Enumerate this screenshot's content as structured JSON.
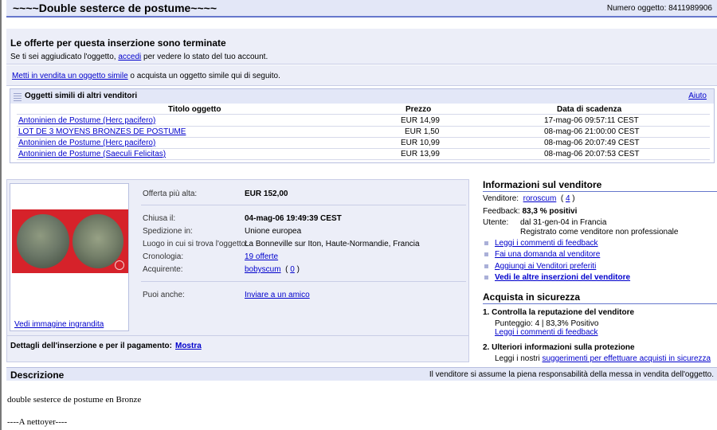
{
  "header": {
    "title": "~~~~Double sesterce de postume~~~~",
    "item_number": "Numero oggetto: 8411989906"
  },
  "ended": {
    "heading": "Le offerte per questa inserzione sono terminate",
    "text_pre": "Se ti sei aggiudicato l'oggetto, ",
    "link": "accedi",
    "text_post": " per vedere lo stato del tuo account."
  },
  "sell_similar": {
    "link": "Metti in vendita un oggetto simile",
    "text": " o acquista un oggetto simile qui di seguito."
  },
  "similar": {
    "title": "Oggetti simili di altri venditori",
    "help": "Aiuto",
    "columns": [
      "Titolo oggetto",
      "Prezzo",
      "Data di scadenza"
    ],
    "rows": [
      {
        "title": "Antoninien de Postume (Herc pacifero)",
        "price": "EUR 14,99",
        "end": "17-mag-06 09:57:11 CEST"
      },
      {
        "title": "LOT DE 3 MOYENS BRONZES DE POSTUME",
        "price": "EUR 1,50",
        "end": "08-mag-06 21:00:00 CEST"
      },
      {
        "title": "Antoninien de Postume (Herc pacifero)",
        "price": "EUR 10,99",
        "end": "08-mag-06 20:07:49 CEST"
      },
      {
        "title": "Antoninien de Postume (Saeculi Felicitas)",
        "price": "EUR 13,99",
        "end": "08-mag-06 20:07:53 CEST"
      }
    ]
  },
  "item": {
    "photo_link": "Vedi immagine ingrandita",
    "top_bid_label": "Offerta più alta:",
    "top_bid_value": "EUR 152,00",
    "closed_label": "Chiusa il:",
    "closed_value": "04-mag-06 19:49:39 CEST",
    "shipping_label": "Spedizione in:",
    "shipping_value": "Unione europea",
    "location_label": "Luogo in cui si trova l'oggetto:",
    "location_value": "La Bonneville sur Iton, Haute-Normandie, Francia",
    "history_label": "Cronologia:",
    "history_value": "19 offerte",
    "buyer_label": "Acquirente:",
    "buyer_name": "bobyscum",
    "buyer_fb_open": "( ",
    "buyer_fb": "0",
    "buyer_fb_close": " )",
    "also_label": "Puoi anche:",
    "also_link": "Inviare a un amico",
    "details_label": "Dettagli dell'inserzione e per il pagamento:",
    "details_link": "Mostra"
  },
  "seller": {
    "heading": "Informazioni sul venditore",
    "seller_label": "Venditore:",
    "seller_name": "roroscum",
    "seller_fb_open": "( ",
    "seller_fb": "4",
    "seller_fb_close": " )",
    "feedback_label": "Feedback:",
    "feedback_value": "83,3 % positivi",
    "user_label": "Utente:",
    "user_line1": "dal 31-gen-04 in Francia",
    "user_line2": "Registrato come venditore non professionale",
    "links": [
      "Leggi i commenti di feedback",
      "Fai una domanda al venditore",
      "Aggiungi ai Venditori preferiti",
      "Vedi le altre inserzioni del venditore"
    ]
  },
  "safety": {
    "heading": "Acquista in sicurezza",
    "item1_title": "1.  Controlla la reputazione del venditore",
    "item1_text": "Punteggio: 4 | 83,3% Positivo",
    "item1_link": "Leggi i commenti di feedback",
    "item2_title": "2.  Ulteriori informazioni sulla protezione",
    "item2_text": "Leggi i nostri ",
    "item2_link": "suggerimenti per effettuare acquisti in sicurezza"
  },
  "description": {
    "title": "Descrizione",
    "note": "Il venditore si assume la piena responsabilità della messa in vendita dell'oggetto.",
    "line1": "double sesterce de postume en Bronze",
    "line2": "----A nettoyer----"
  },
  "colors": {
    "accent": "#6677cc",
    "panel": "#eceef8",
    "link": "#0000cc",
    "photo_bg": "#d6222a"
  }
}
